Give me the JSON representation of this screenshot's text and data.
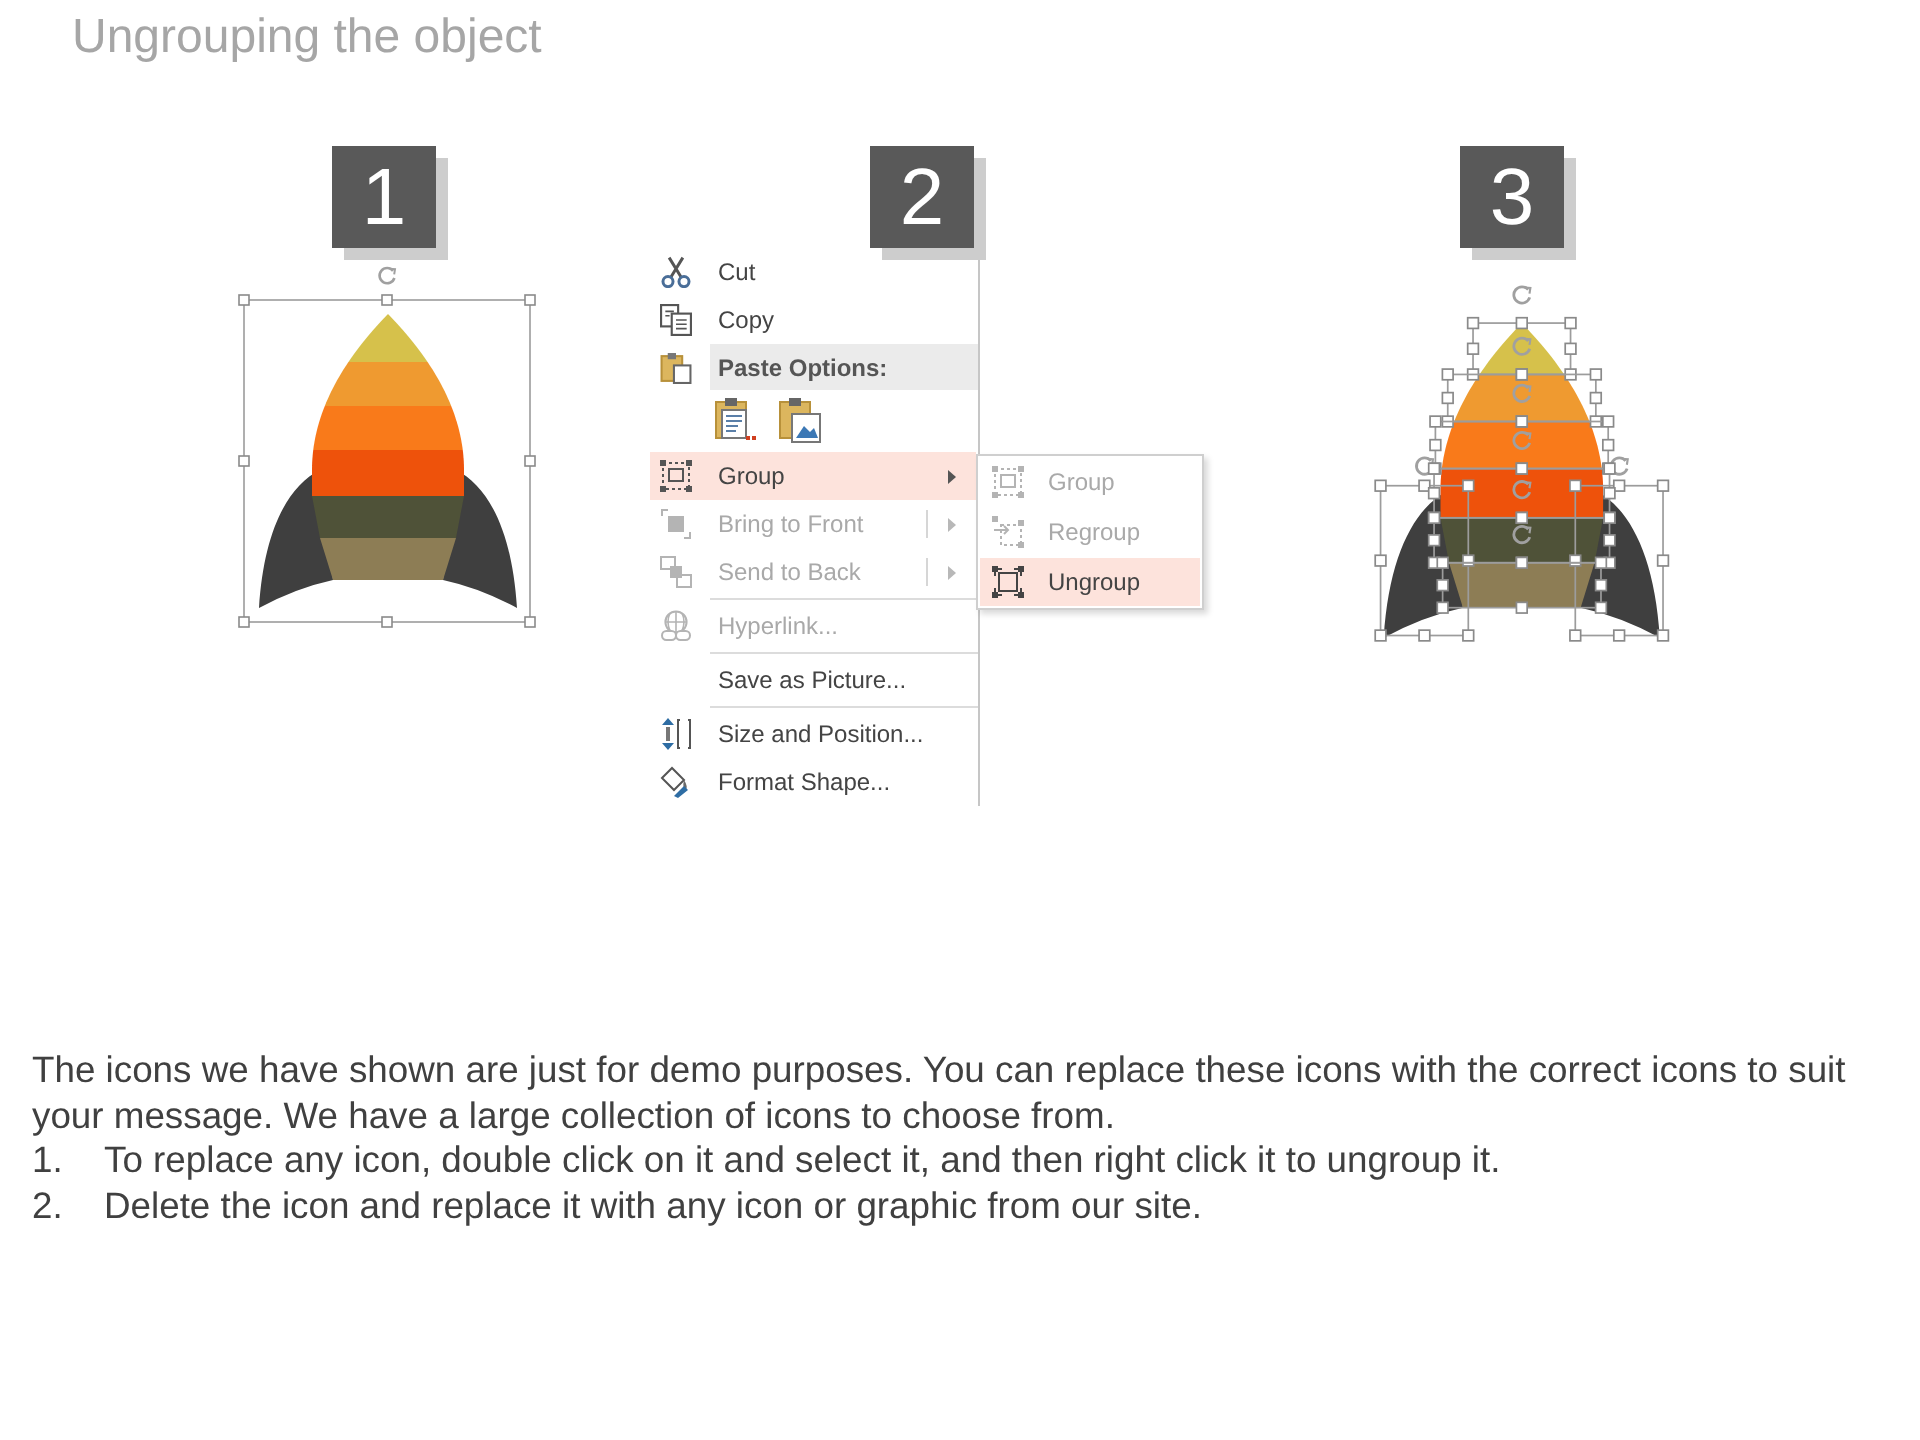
{
  "title": "Ungrouping the object",
  "panels": [
    {
      "kind": "grouped",
      "number": "1"
    },
    {
      "kind": "menu",
      "number": "2",
      "menu": {
        "items": [
          {
            "kind": "item",
            "label": "Cut",
            "disabled": false,
            "selected": false,
            "arrow": false
          },
          {
            "kind": "item",
            "label": "Copy",
            "disabled": false,
            "selected": false,
            "arrow": false
          },
          {
            "kind": "header",
            "label": "Paste Options:"
          },
          {
            "kind": "paste_row"
          },
          {
            "kind": "item",
            "label": "Group",
            "disabled": false,
            "selected": true,
            "arrow": true
          },
          {
            "kind": "split",
            "label": "Bring to Front",
            "disabled": true,
            "selected": false,
            "arrow": true
          },
          {
            "kind": "split",
            "label": "Send to Back",
            "disabled": true,
            "selected": false,
            "arrow": true
          },
          {
            "kind": "separator"
          },
          {
            "kind": "item",
            "label": "Hyperlink...",
            "disabled": true,
            "selected": false,
            "arrow": false
          },
          {
            "kind": "separator"
          },
          {
            "kind": "item",
            "label": "Save as Picture...",
            "disabled": false,
            "selected": false,
            "arrow": false
          },
          {
            "kind": "separator"
          },
          {
            "kind": "item",
            "label": "Size and Position...",
            "disabled": false,
            "selected": false,
            "arrow": false
          },
          {
            "kind": "item",
            "label": "Format Shape...",
            "disabled": false,
            "selected": false,
            "arrow": false
          }
        ],
        "submenu": {
          "items": [
            {
              "label": "Group",
              "disabled": true,
              "selected": false
            },
            {
              "label": "Regroup",
              "disabled": true,
              "selected": false
            },
            {
              "label": "Ungroup",
              "disabled": false,
              "selected": true
            }
          ]
        }
      }
    },
    {
      "kind": "ungrouped",
      "number": "3"
    }
  ],
  "notes": {
    "intro": "The icons we have shown are just for demo purposes. You can replace these icons with the correct icons to suit your message. We have a large collection of icons to choose from.",
    "steps": [
      {
        "number": "1.",
        "text": "To replace any icon, double click on it and select it, and then right click it to ungroup it."
      },
      {
        "number": "2.",
        "text": "Delete the icon and replace it with any icon or graphic from our site."
      }
    ]
  }
}
